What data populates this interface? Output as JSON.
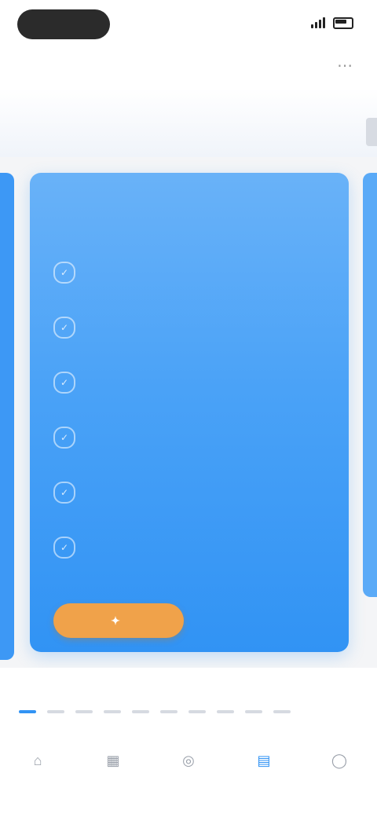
{
  "status": {
    "time": "",
    "pill": ""
  },
  "nav": {
    "title": "",
    "action_icon": "more-icon"
  },
  "tabs": {
    "active": "",
    "secondary": ""
  },
  "card": {
    "title": "",
    "subtitle": "",
    "items": [
      {
        "label": ""
      },
      {
        "label": ""
      },
      {
        "label": ""
      },
      {
        "label": ""
      },
      {
        "label": ""
      },
      {
        "label": ""
      }
    ],
    "cta": {
      "label": "",
      "icon": "sparkle-icon"
    }
  },
  "pager": {
    "label": "",
    "count": 10,
    "active_index": 0
  },
  "tabbar": [
    {
      "label": "",
      "icon": "home-icon"
    },
    {
      "label": "",
      "icon": "grid-icon"
    },
    {
      "label": "",
      "icon": "compass-icon"
    },
    {
      "label": "",
      "icon": "chart-icon",
      "active": true
    },
    {
      "label": "",
      "icon": "user-icon"
    }
  ],
  "colors": {
    "accent": "#3193f4",
    "card_top": "#69b2f8",
    "card_bottom": "#3193f4",
    "cta": "#f0a24a"
  }
}
